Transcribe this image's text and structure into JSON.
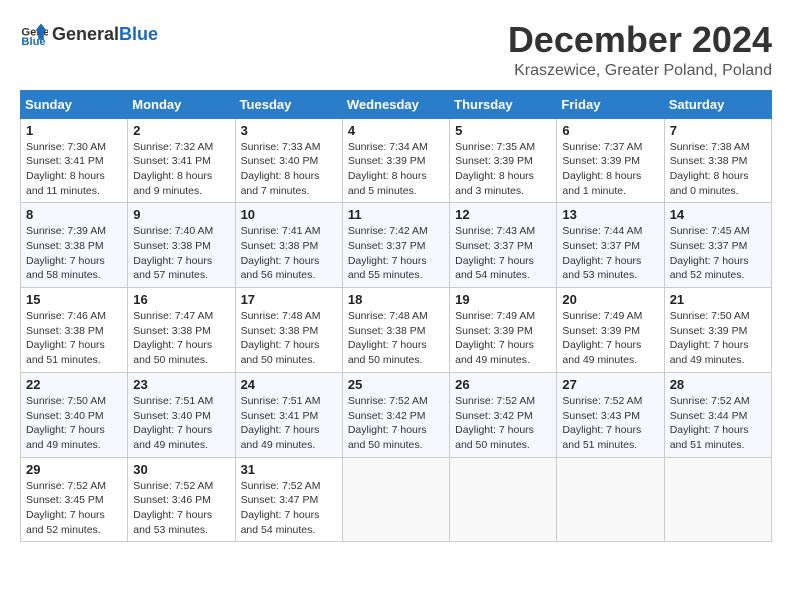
{
  "header": {
    "logo_general": "General",
    "logo_blue": "Blue",
    "month_title": "December 2024",
    "subtitle": "Kraszewice, Greater Poland, Poland"
  },
  "weekdays": [
    "Sunday",
    "Monday",
    "Tuesday",
    "Wednesday",
    "Thursday",
    "Friday",
    "Saturday"
  ],
  "weeks": [
    [
      {
        "day": "1",
        "sunrise": "Sunrise: 7:30 AM",
        "sunset": "Sunset: 3:41 PM",
        "daylight": "Daylight: 8 hours and 11 minutes."
      },
      {
        "day": "2",
        "sunrise": "Sunrise: 7:32 AM",
        "sunset": "Sunset: 3:41 PM",
        "daylight": "Daylight: 8 hours and 9 minutes."
      },
      {
        "day": "3",
        "sunrise": "Sunrise: 7:33 AM",
        "sunset": "Sunset: 3:40 PM",
        "daylight": "Daylight: 8 hours and 7 minutes."
      },
      {
        "day": "4",
        "sunrise": "Sunrise: 7:34 AM",
        "sunset": "Sunset: 3:39 PM",
        "daylight": "Daylight: 8 hours and 5 minutes."
      },
      {
        "day": "5",
        "sunrise": "Sunrise: 7:35 AM",
        "sunset": "Sunset: 3:39 PM",
        "daylight": "Daylight: 8 hours and 3 minutes."
      },
      {
        "day": "6",
        "sunrise": "Sunrise: 7:37 AM",
        "sunset": "Sunset: 3:39 PM",
        "daylight": "Daylight: 8 hours and 1 minute."
      },
      {
        "day": "7",
        "sunrise": "Sunrise: 7:38 AM",
        "sunset": "Sunset: 3:38 PM",
        "daylight": "Daylight: 8 hours and 0 minutes."
      }
    ],
    [
      {
        "day": "8",
        "sunrise": "Sunrise: 7:39 AM",
        "sunset": "Sunset: 3:38 PM",
        "daylight": "Daylight: 7 hours and 58 minutes."
      },
      {
        "day": "9",
        "sunrise": "Sunrise: 7:40 AM",
        "sunset": "Sunset: 3:38 PM",
        "daylight": "Daylight: 7 hours and 57 minutes."
      },
      {
        "day": "10",
        "sunrise": "Sunrise: 7:41 AM",
        "sunset": "Sunset: 3:38 PM",
        "daylight": "Daylight: 7 hours and 56 minutes."
      },
      {
        "day": "11",
        "sunrise": "Sunrise: 7:42 AM",
        "sunset": "Sunset: 3:37 PM",
        "daylight": "Daylight: 7 hours and 55 minutes."
      },
      {
        "day": "12",
        "sunrise": "Sunrise: 7:43 AM",
        "sunset": "Sunset: 3:37 PM",
        "daylight": "Daylight: 7 hours and 54 minutes."
      },
      {
        "day": "13",
        "sunrise": "Sunrise: 7:44 AM",
        "sunset": "Sunset: 3:37 PM",
        "daylight": "Daylight: 7 hours and 53 minutes."
      },
      {
        "day": "14",
        "sunrise": "Sunrise: 7:45 AM",
        "sunset": "Sunset: 3:37 PM",
        "daylight": "Daylight: 7 hours and 52 minutes."
      }
    ],
    [
      {
        "day": "15",
        "sunrise": "Sunrise: 7:46 AM",
        "sunset": "Sunset: 3:38 PM",
        "daylight": "Daylight: 7 hours and 51 minutes."
      },
      {
        "day": "16",
        "sunrise": "Sunrise: 7:47 AM",
        "sunset": "Sunset: 3:38 PM",
        "daylight": "Daylight: 7 hours and 50 minutes."
      },
      {
        "day": "17",
        "sunrise": "Sunrise: 7:48 AM",
        "sunset": "Sunset: 3:38 PM",
        "daylight": "Daylight: 7 hours and 50 minutes."
      },
      {
        "day": "18",
        "sunrise": "Sunrise: 7:48 AM",
        "sunset": "Sunset: 3:38 PM",
        "daylight": "Daylight: 7 hours and 50 minutes."
      },
      {
        "day": "19",
        "sunrise": "Sunrise: 7:49 AM",
        "sunset": "Sunset: 3:39 PM",
        "daylight": "Daylight: 7 hours and 49 minutes."
      },
      {
        "day": "20",
        "sunrise": "Sunrise: 7:49 AM",
        "sunset": "Sunset: 3:39 PM",
        "daylight": "Daylight: 7 hours and 49 minutes."
      },
      {
        "day": "21",
        "sunrise": "Sunrise: 7:50 AM",
        "sunset": "Sunset: 3:39 PM",
        "daylight": "Daylight: 7 hours and 49 minutes."
      }
    ],
    [
      {
        "day": "22",
        "sunrise": "Sunrise: 7:50 AM",
        "sunset": "Sunset: 3:40 PM",
        "daylight": "Daylight: 7 hours and 49 minutes."
      },
      {
        "day": "23",
        "sunrise": "Sunrise: 7:51 AM",
        "sunset": "Sunset: 3:40 PM",
        "daylight": "Daylight: 7 hours and 49 minutes."
      },
      {
        "day": "24",
        "sunrise": "Sunrise: 7:51 AM",
        "sunset": "Sunset: 3:41 PM",
        "daylight": "Daylight: 7 hours and 49 minutes."
      },
      {
        "day": "25",
        "sunrise": "Sunrise: 7:52 AM",
        "sunset": "Sunset: 3:42 PM",
        "daylight": "Daylight: 7 hours and 50 minutes."
      },
      {
        "day": "26",
        "sunrise": "Sunrise: 7:52 AM",
        "sunset": "Sunset: 3:42 PM",
        "daylight": "Daylight: 7 hours and 50 minutes."
      },
      {
        "day": "27",
        "sunrise": "Sunrise: 7:52 AM",
        "sunset": "Sunset: 3:43 PM",
        "daylight": "Daylight: 7 hours and 51 minutes."
      },
      {
        "day": "28",
        "sunrise": "Sunrise: 7:52 AM",
        "sunset": "Sunset: 3:44 PM",
        "daylight": "Daylight: 7 hours and 51 minutes."
      }
    ],
    [
      {
        "day": "29",
        "sunrise": "Sunrise: 7:52 AM",
        "sunset": "Sunset: 3:45 PM",
        "daylight": "Daylight: 7 hours and 52 minutes."
      },
      {
        "day": "30",
        "sunrise": "Sunrise: 7:52 AM",
        "sunset": "Sunset: 3:46 PM",
        "daylight": "Daylight: 7 hours and 53 minutes."
      },
      {
        "day": "31",
        "sunrise": "Sunrise: 7:52 AM",
        "sunset": "Sunset: 3:47 PM",
        "daylight": "Daylight: 7 hours and 54 minutes."
      },
      null,
      null,
      null,
      null
    ]
  ]
}
